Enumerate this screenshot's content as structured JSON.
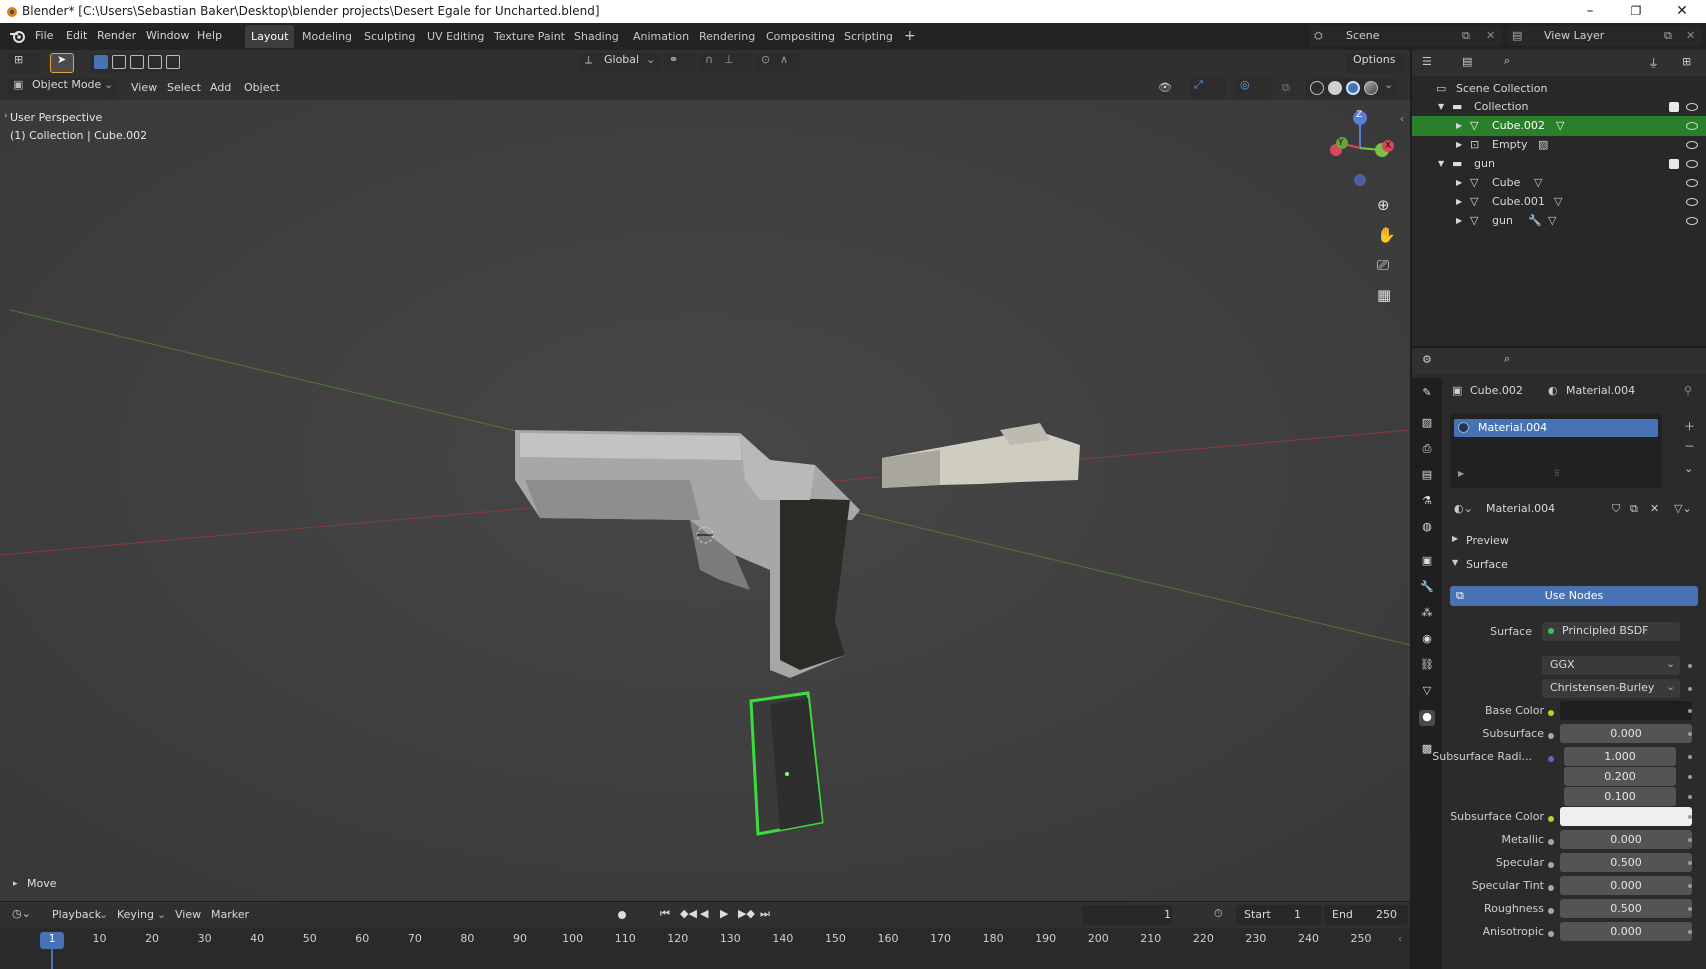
{
  "window": {
    "title": "Blender* [C:\\Users\\Sebastian Baker\\Desktop\\blender projects\\Desert Egale for Uncharted.blend]",
    "controls": [
      "–",
      "❐",
      "✕"
    ]
  },
  "menus": [
    "File",
    "Edit",
    "Render",
    "Window",
    "Help"
  ],
  "workspaces": [
    {
      "label": "Layout",
      "active": true
    },
    {
      "label": "Modeling"
    },
    {
      "label": "Sculpting"
    },
    {
      "label": "UV Editing"
    },
    {
      "label": "Texture Paint"
    },
    {
      "label": "Shading"
    },
    {
      "label": "Animation"
    },
    {
      "label": "Rendering"
    },
    {
      "label": "Compositing"
    },
    {
      "label": "Scripting"
    }
  ],
  "add_workspace": "+",
  "scene": {
    "label": "Scene",
    "view_layer": "View Layer"
  },
  "toolbar": {
    "orientation": "Global",
    "options": "Options"
  },
  "viewport": {
    "mode": "Object Mode",
    "menu": [
      "View",
      "Select",
      "Add",
      "Object"
    ],
    "perspective": "User Perspective",
    "context": "(1) Collection | Cube.002",
    "last_op": "Move",
    "gizmo": {
      "z": "Z",
      "y": "Y",
      "x": "X"
    }
  },
  "outliner": {
    "root": "Scene Collection",
    "rows": [
      {
        "label": "Collection",
        "type": "collection"
      },
      {
        "label": "Cube.002",
        "type": "mesh",
        "selected": true
      },
      {
        "label": "Empty",
        "type": "empty"
      },
      {
        "label": "gun",
        "type": "collection"
      },
      {
        "label": "Cube",
        "type": "mesh"
      },
      {
        "label": "Cube.001",
        "type": "mesh"
      },
      {
        "label": "gun",
        "type": "mesh"
      }
    ]
  },
  "properties": {
    "breadcrumb_object": "Cube.002",
    "breadcrumb_material": "Material.004",
    "slot": "Material.004",
    "material_name": "Material.004",
    "sections": {
      "preview": "Preview",
      "surface": "Surface"
    },
    "use_nodes": "Use Nodes",
    "surface_label": "Surface",
    "surface_value": "Principled BSDF",
    "distribution": "GGX",
    "subsurface_method": "Christensen-Burley",
    "fields": [
      {
        "label": "Base Color",
        "value": "",
        "kind": "color-dark"
      },
      {
        "label": "Subsurface",
        "value": "0.000"
      },
      {
        "label": "Subsurface Radi...",
        "value": "1.000"
      },
      {
        "label": "",
        "value": "0.200"
      },
      {
        "label": "",
        "value": "0.100"
      },
      {
        "label": "Subsurface Color",
        "value": "",
        "kind": "color-white"
      },
      {
        "label": "Metallic",
        "value": "0.000"
      },
      {
        "label": "Specular",
        "value": "0.500"
      },
      {
        "label": "Specular Tint",
        "value": "0.000"
      },
      {
        "label": "Roughness",
        "value": "0.500"
      },
      {
        "label": "Anisotropic",
        "value": "0.000"
      }
    ]
  },
  "timeline": {
    "menu": [
      "Playback",
      "Keying",
      "View",
      "Marker"
    ],
    "current_frame": "1",
    "start_label": "Start",
    "start": "1",
    "end_label": "End",
    "end": "250",
    "ruler": [
      "1",
      "10",
      "20",
      "30",
      "40",
      "50",
      "60",
      "70",
      "80",
      "90",
      "100",
      "110",
      "120",
      "130",
      "140",
      "150",
      "160",
      "170",
      "180",
      "190",
      "200",
      "210",
      "220",
      "230",
      "240",
      "250"
    ]
  },
  "colors": {
    "accent_blue": "#4772b3",
    "select_green": "#2a7f2a",
    "outline_green": "#3cdc3c"
  }
}
